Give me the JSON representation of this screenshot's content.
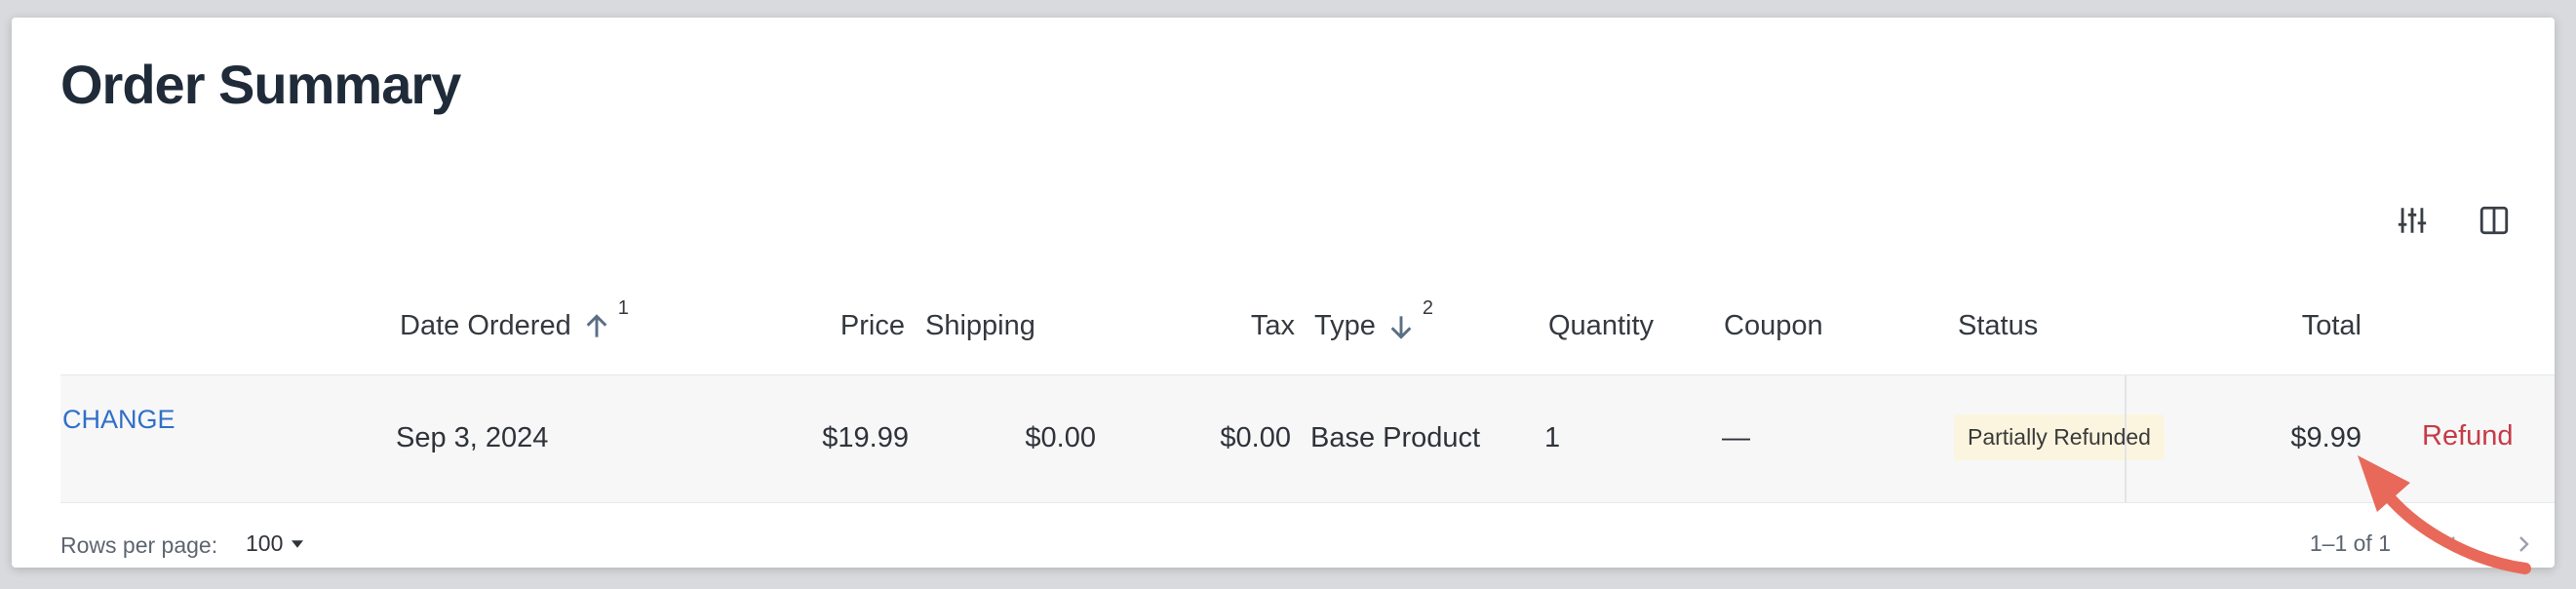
{
  "page": {
    "title": "Order Summary"
  },
  "toolbar": {
    "filters_icon": "sliders-icon",
    "columns_icon": "columns-icon"
  },
  "table": {
    "headers": {
      "date_ordered": "Date Ordered",
      "date_sort_order": "1",
      "price": "Price",
      "shipping": "Shipping",
      "tax": "Tax",
      "type": "Type",
      "type_sort_order": "2",
      "quantity": "Quantity",
      "coupon": "Coupon",
      "status": "Status",
      "total": "Total"
    },
    "rows": [
      {
        "action": "CHANGE",
        "date_ordered": "Sep 3, 2024",
        "price": "$19.99",
        "shipping": "$0.00",
        "tax": "$0.00",
        "type": "Base Product",
        "quantity": "1",
        "coupon": "—",
        "status": "Partially Refunded",
        "total": "$9.99",
        "refund": "Refund"
      }
    ]
  },
  "footer": {
    "rows_per_page_label": "Rows per page:",
    "rows_per_page_value": "100",
    "pagination_text": "1–1 of 1"
  },
  "colors": {
    "accent": "#2f6fc9",
    "danger": "#c63b46",
    "badge_bg": "#fbf5df",
    "annotation_arrow": "#e8695a"
  }
}
